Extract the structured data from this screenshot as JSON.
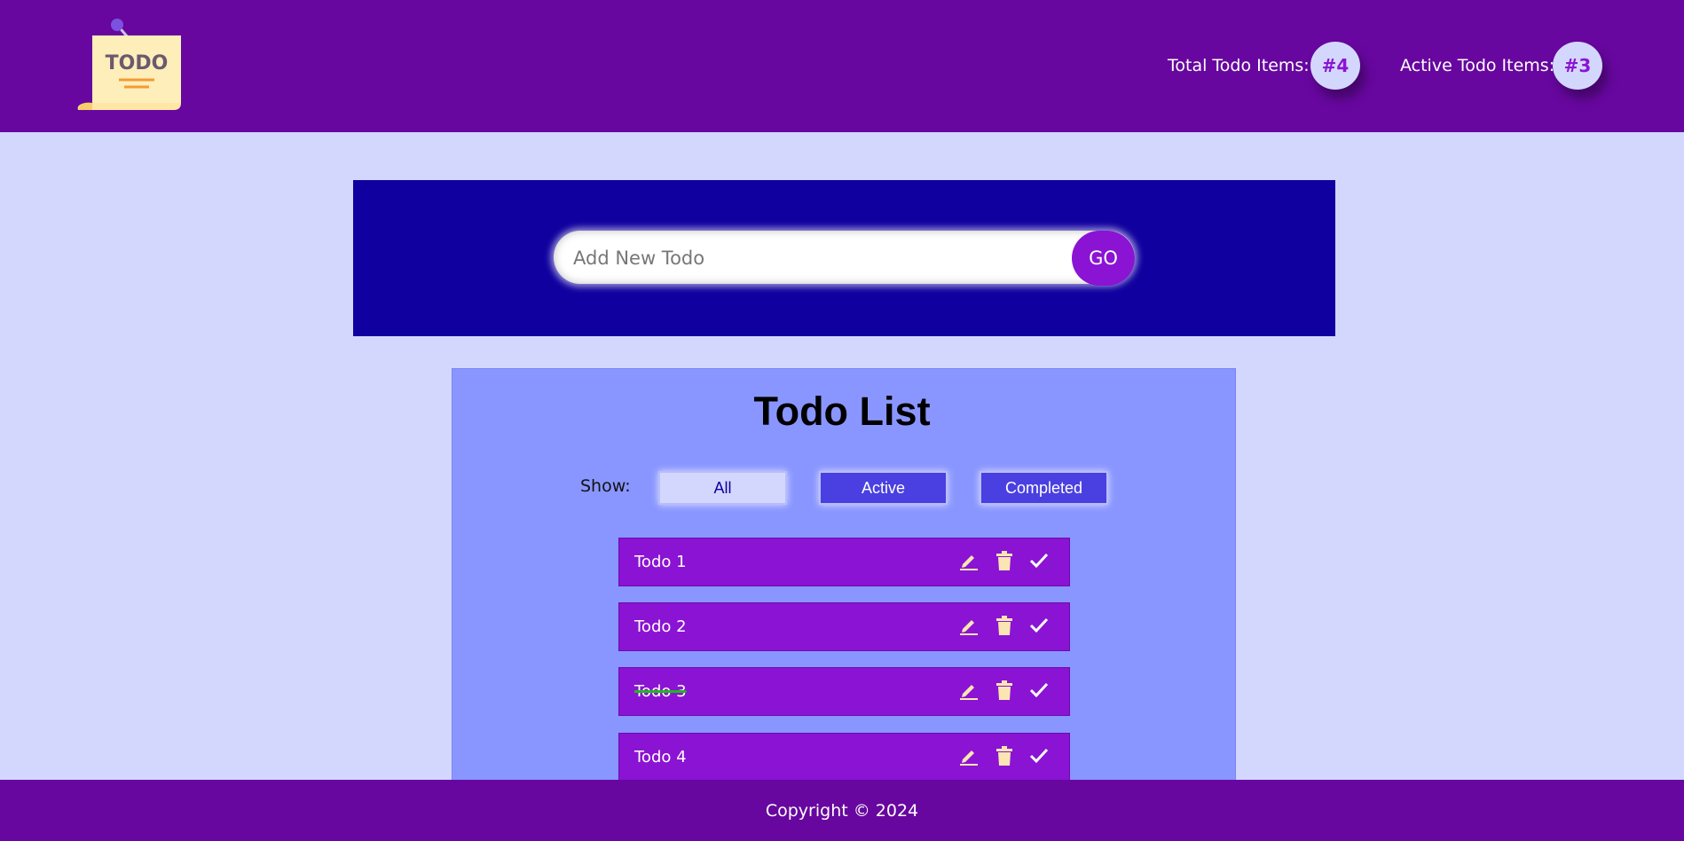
{
  "header": {
    "logo_text": "TODO",
    "total_label": "Total Todo Items:",
    "total_count": "#4",
    "active_label": "Active Todo Items:",
    "active_count": "#3"
  },
  "new_todo": {
    "placeholder": "Add New Todo",
    "value": "",
    "go_label": "GO"
  },
  "list": {
    "title": "Todo List",
    "show_label": "Show:",
    "filters": [
      {
        "label": "All",
        "selected": true
      },
      {
        "label": "Active",
        "selected": false
      },
      {
        "label": "Completed",
        "selected": false
      }
    ],
    "items": [
      {
        "text": "Todo 1",
        "completed": false
      },
      {
        "text": "Todo 2",
        "completed": false
      },
      {
        "text": "Todo 3",
        "completed": true
      },
      {
        "text": "Todo 4",
        "completed": false
      }
    ],
    "item_icons": [
      "edit-icon",
      "trash-icon",
      "check-icon"
    ]
  },
  "footer": {
    "copyright": "Copyright © 2024"
  },
  "colors": {
    "header_bg": "#67079f",
    "page_bg": "#d3d7fd",
    "input_panel_bg": "#10009f",
    "list_panel_bg": "#8996ff",
    "accent": "#8b13d3",
    "filter_unselected_bg": "#4a3fe0",
    "completed_strike": "#1fb81f"
  }
}
